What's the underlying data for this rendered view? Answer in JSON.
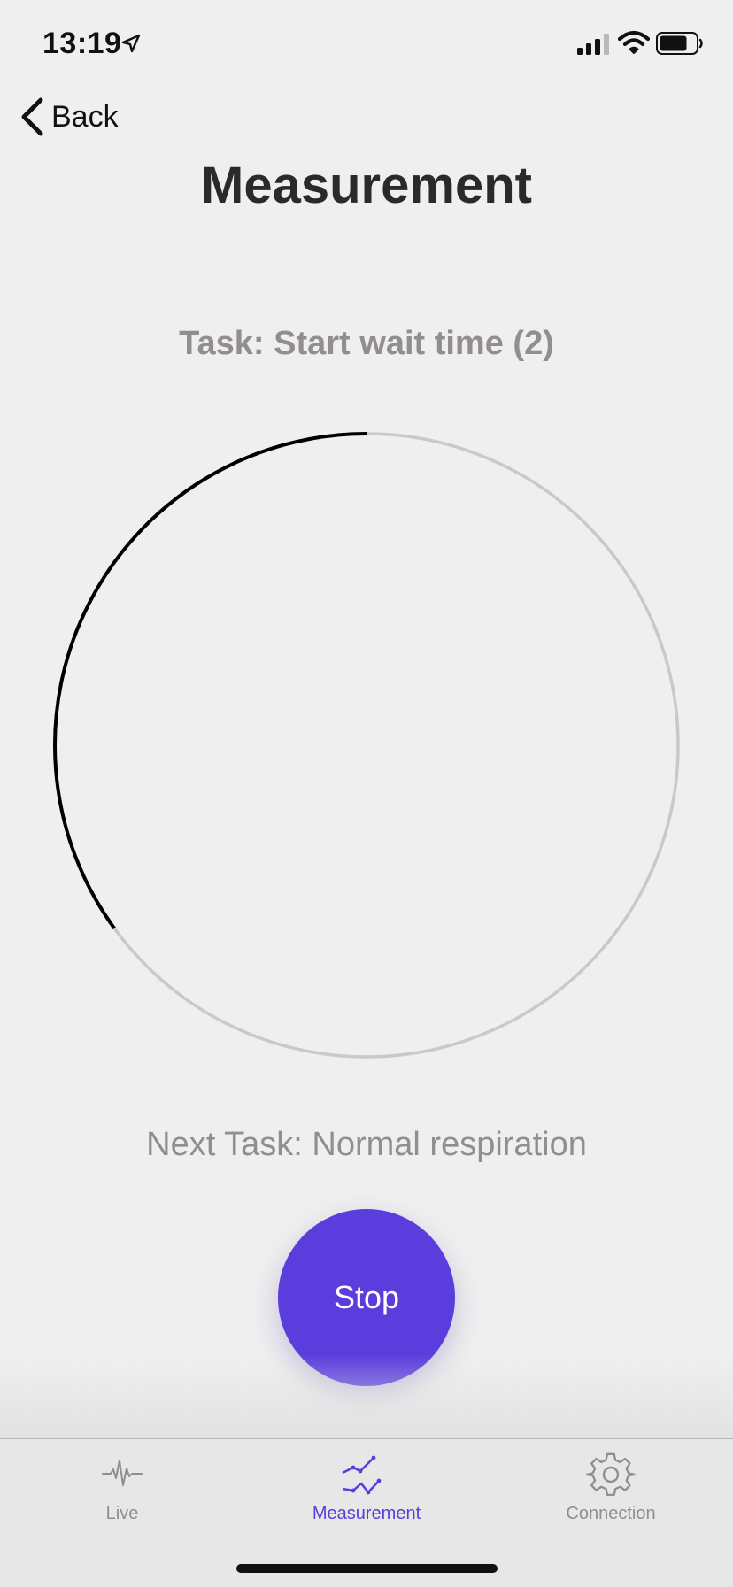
{
  "status_bar": {
    "time": "13:19",
    "icons": [
      "location-arrow-icon",
      "cellular-signal-icon",
      "wifi-icon",
      "battery-icon"
    ]
  },
  "nav": {
    "back_label": "Back",
    "title": "Measurement"
  },
  "measurement": {
    "task_label": "Task: Start wait time (2)",
    "progress_fraction": 0.35,
    "next_task_label": "Next Task: Normal respiration",
    "stop_label": "Stop"
  },
  "tab_bar": {
    "tabs": [
      {
        "label": "Live",
        "icon": "pulse-icon",
        "active": false
      },
      {
        "label": "Measurement",
        "icon": "line-graph-icon",
        "active": true
      },
      {
        "label": "Connection",
        "icon": "gear-icon",
        "active": false
      }
    ]
  },
  "colors": {
    "accent": "#5b3ddd",
    "background": "#efefef",
    "secondary_text": "#938e8e",
    "ring_track": "#c9c9c9",
    "ring_progress": "#000000"
  }
}
